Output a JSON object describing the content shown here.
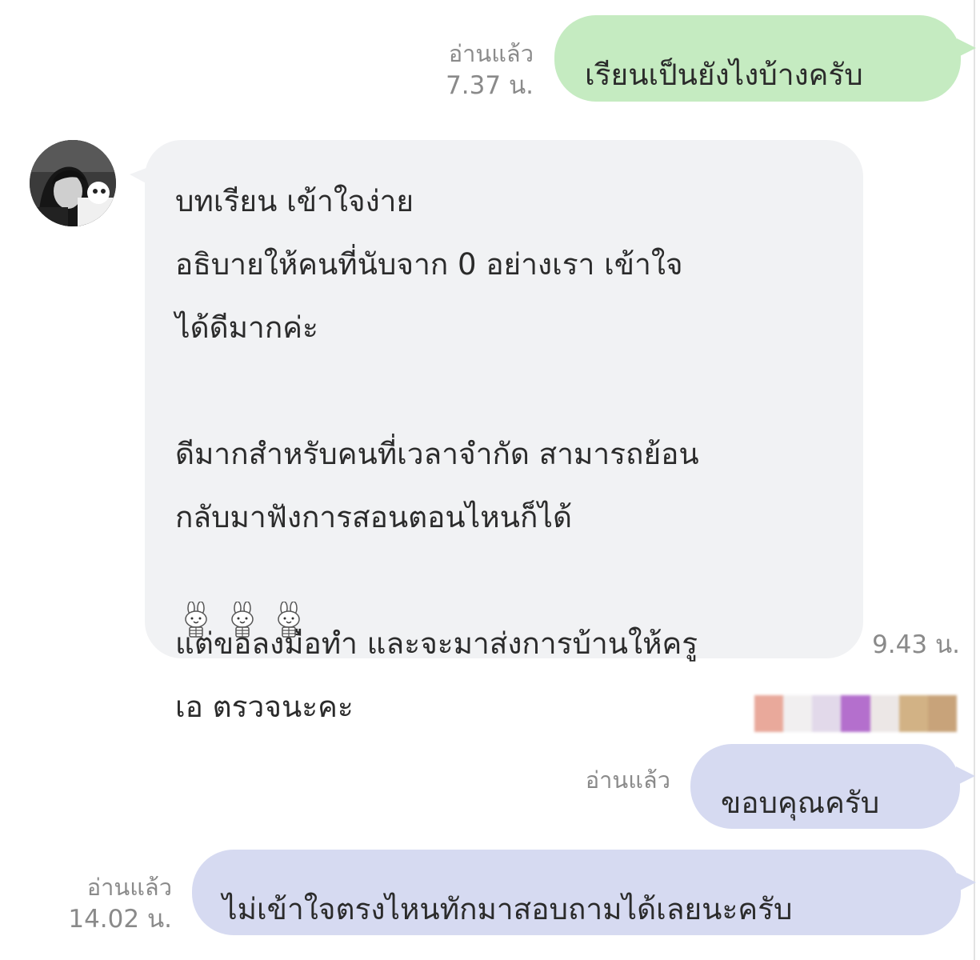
{
  "messages": [
    {
      "id": "m1",
      "side": "right",
      "text": "เรียนเป็นยังไงบ้างครับ",
      "read": "อ่านแล้ว",
      "time": "7.37 น.",
      "color": "#c5ebc1"
    },
    {
      "id": "m2",
      "side": "left",
      "lines": [
        "บทเรียน เข้าใจง่าย",
        "อธิบายให้คนที่นับจาก 0 อย่างเรา เข้าใจ",
        "ได้ดีมากค่ะ",
        "",
        "ดีมากสำหรับคนที่เวลาจำกัด สามารถย้อน",
        "กลับมาฟังการสอนตอนไหนก็ได้",
        "",
        "แต่ขอลงมือทำ และจะมาส่งการบ้านให้ครู",
        "เอ ตรวจนะคะ"
      ],
      "emoji": [
        "bunny-emoji",
        "bunny-emoji",
        "bunny-emoji"
      ],
      "time": "9.43 น.",
      "color": "#f1f2f4"
    },
    {
      "id": "m3",
      "side": "right",
      "text": "ขอบคุณครับ",
      "read": "อ่านแล้ว",
      "color": "#d6daf1"
    },
    {
      "id": "m4",
      "side": "right",
      "text": "ไม่เข้าใจตรงไหนทักมาสอบถามได้เลยนะครับ",
      "read": "อ่านแล้ว",
      "time": "14.02 น.",
      "color": "#d6daf1"
    }
  ],
  "sticker_colors": [
    "#e9a99b",
    "#f1eff0",
    "#e2d9ea",
    "#b46fcd",
    "#ece7e6",
    "#d2b285",
    "#c8a37a"
  ]
}
